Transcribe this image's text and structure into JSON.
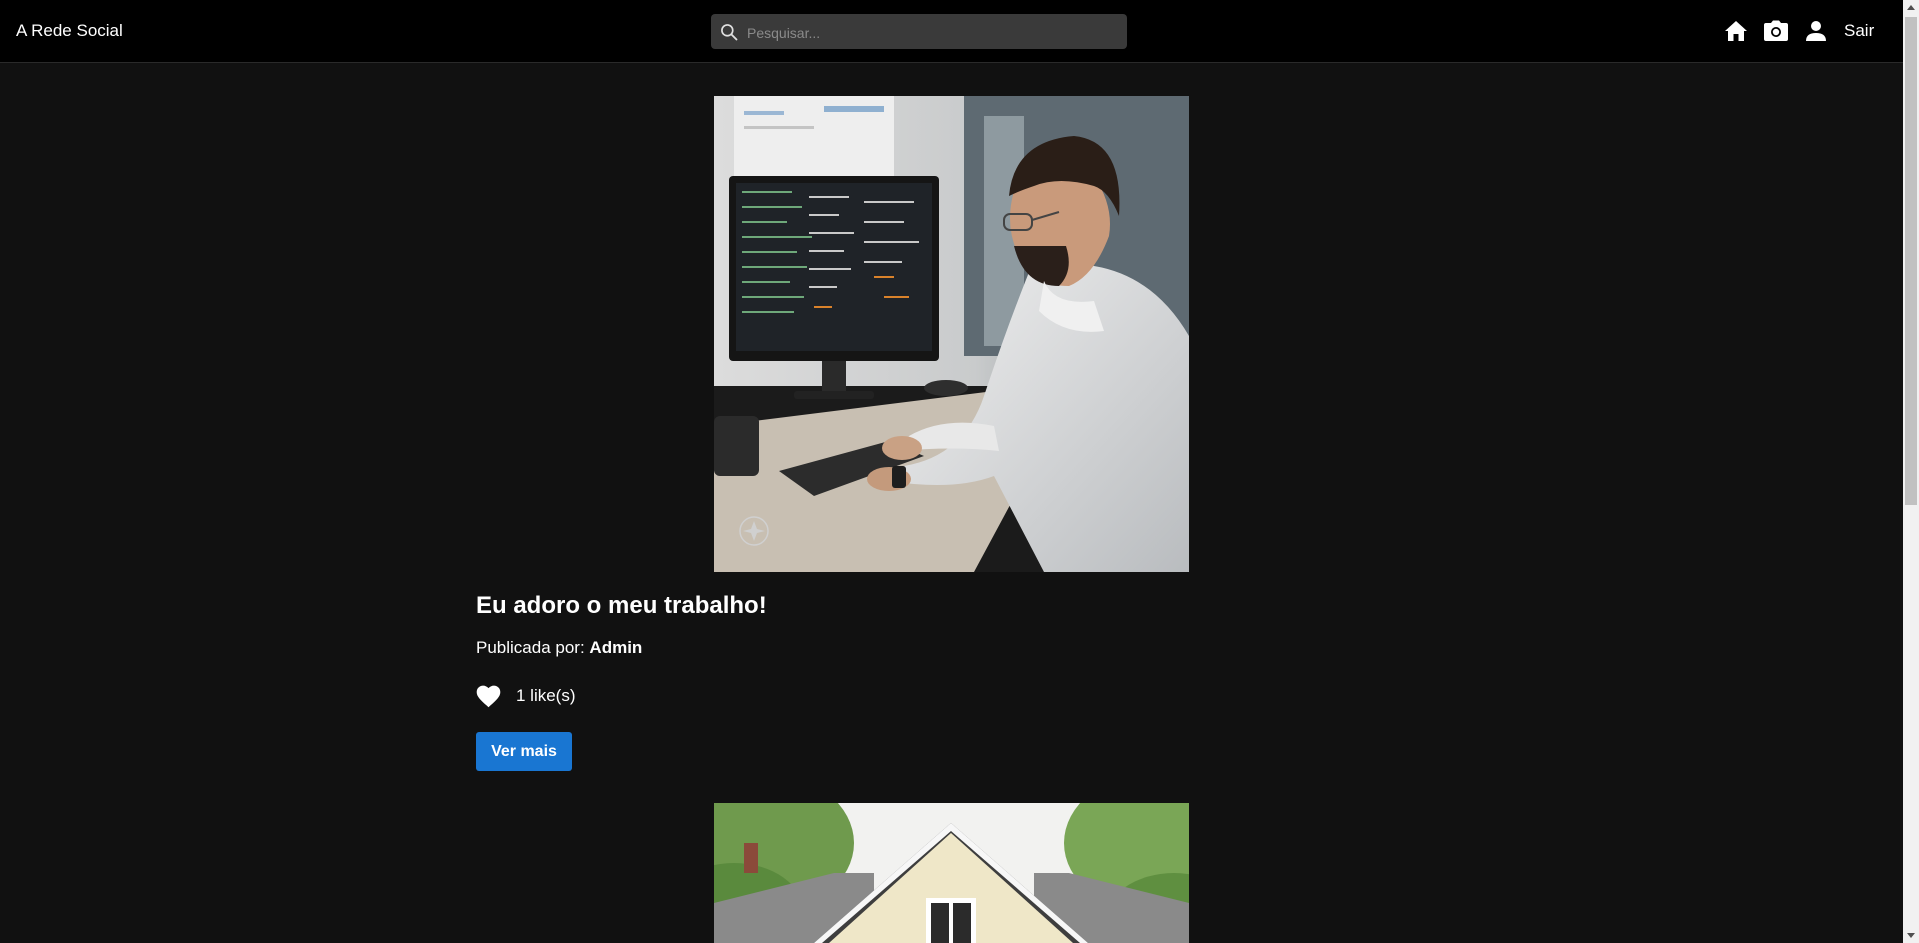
{
  "header": {
    "brand": "A Rede Social",
    "search_placeholder": "Pesquisar...",
    "nav": {
      "home_icon": "home-icon",
      "camera_icon": "camera-icon",
      "profile_icon": "person-icon",
      "logout_label": "Sair"
    }
  },
  "posts": [
    {
      "title": "Eu adoro o meu trabalho!",
      "author_prefix": "Publicada por:",
      "author": "Admin",
      "likes_text": "1 like(s)",
      "more_label": "Ver mais"
    }
  ],
  "colors": {
    "background": "#111111",
    "topbar": "#000000",
    "accent": "#1976d2"
  }
}
